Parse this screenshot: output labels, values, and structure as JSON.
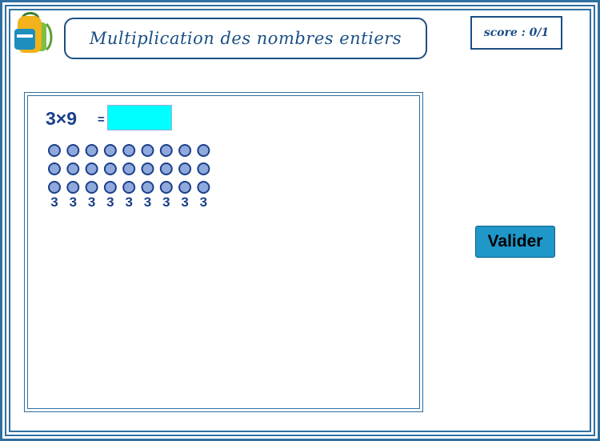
{
  "title": "Multiplication des nombres entiers",
  "score": "score : 0/1",
  "exercise": {
    "expression": "3×9",
    "equals": "=",
    "answer_value": "",
    "rows": 3,
    "columns": 9,
    "column_label": "3"
  },
  "validate_label": "Valider",
  "colors": {
    "frame": "#2f6fa0",
    "title_text": "#1b4f84",
    "dot_fill": "#8fa9dc",
    "dot_stroke": "#1b3f8a",
    "answer_bg": "#00ffff",
    "button_bg": "#1f97c8"
  },
  "icons": {
    "logo": "backpack-icon"
  }
}
